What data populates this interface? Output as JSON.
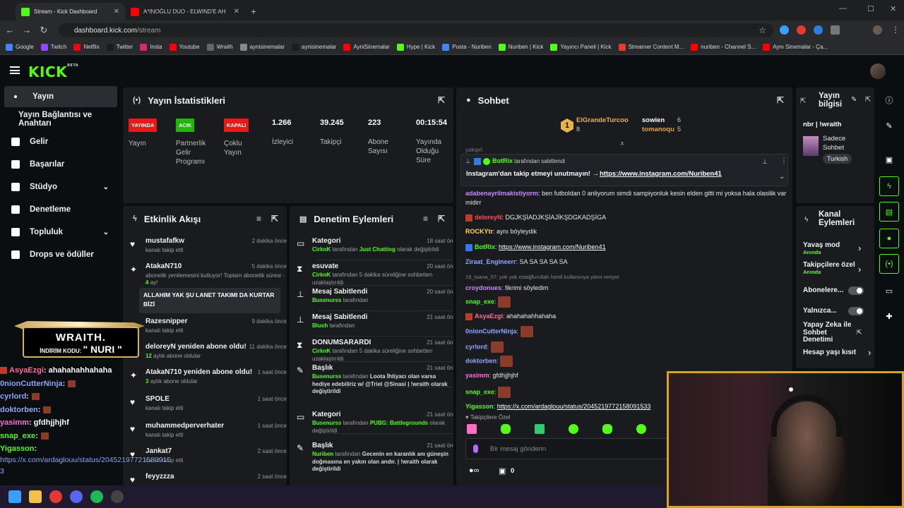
{
  "browser": {
    "tabs": [
      {
        "title": "Stream - Kick Dashboard",
        "color": "#53fc18"
      },
      {
        "title": "A*INOĞLU DUO - ELWIND'E AH",
        "color": "#ff0000"
      }
    ],
    "url_host": "dashboard.kick.com",
    "url_path": "/stream",
    "bookmarks": [
      {
        "label": "Google",
        "color": "#4285f4"
      },
      {
        "label": "Twitch",
        "color": "#9146ff"
      },
      {
        "label": "Netflix",
        "color": "#e50914"
      },
      {
        "label": "Twitter",
        "color": "#1d1d1d"
      },
      {
        "label": "Insta",
        "color": "#d62976"
      },
      {
        "label": "Youtube",
        "color": "#ff0000"
      },
      {
        "label": "Wraith",
        "color": "#666666"
      },
      {
        "label": "aynisinemalar",
        "color": "#888888"
      },
      {
        "label": "aynisinemalar",
        "color": "#1d1d1d"
      },
      {
        "label": "AyniSinemalar",
        "color": "#ff0000"
      },
      {
        "label": "Hype | Kick",
        "color": "#53fc18"
      },
      {
        "label": "Posta - Nuriben",
        "color": "#4285f4"
      },
      {
        "label": "Nuriben | Kick",
        "color": "#53fc18"
      },
      {
        "label": "Yayıncı Paneli | Kick",
        "color": "#53fc18"
      },
      {
        "label": "Streamer Content M...",
        "color": "#e53935"
      },
      {
        "label": "nuriben - Channel S...",
        "color": "#ff0000"
      },
      {
        "label": "Aynı Sinemalar - Ça...",
        "color": "#ff0000"
      }
    ]
  },
  "logo": {
    "text": "KICK",
    "beta": "BETA"
  },
  "sidebar": {
    "items": [
      {
        "label": "Yayın"
      },
      {
        "label": "Yayın Bağlantısı ve Anahtarı"
      },
      {
        "label": "Gelir"
      },
      {
        "label": "Başarılar"
      },
      {
        "label": "Stüdyo"
      },
      {
        "label": "Denetleme"
      },
      {
        "label": "Topluluk"
      },
      {
        "label": "Drops ve ödüller"
      }
    ]
  },
  "overlay": {
    "promo_title": "WRAITH.",
    "promo_code_label": "İNDİRİM KODU:",
    "promo_code": "\" NURI \"",
    "chat": [
      {
        "user": "AsyaEzgi",
        "color": "#ff6e9c",
        "msg": "ahahahahhahaha"
      },
      {
        "user": "0nionCutterNinja",
        "color": "#8fa8ff",
        "msg": ""
      },
      {
        "user": "cyrlord",
        "color": "#8fa8ff",
        "msg": ""
      },
      {
        "user": "doktorben",
        "color": "#8fa8ff",
        "msg": ""
      },
      {
        "user": "yasimm",
        "color": "#ff6ee0",
        "msg": "gfdhjjhjhf"
      },
      {
        "user": "snap_exe",
        "color": "#53fc18",
        "msg": ""
      },
      {
        "user": "Yigasson",
        "color": "#53fc18",
        "msg": ""
      }
    ],
    "link_line1": "https://x.com/ardaglouu/status/20452197721580915",
    "link_line2": "3"
  },
  "stats": {
    "title": "Yayın İstatistikleri",
    "items": [
      {
        "badge": "YAYINDA",
        "color": "#e91916",
        "label": "Yayın"
      },
      {
        "badge": "ACIK",
        "color": "#1db800",
        "label": "Partnerlik Gelir Programı"
      },
      {
        "badge": "KAPALI",
        "color": "#e91916",
        "label": "Çoklu Yayın"
      },
      {
        "value": "1.266",
        "label": "İzleyici"
      },
      {
        "value": "39.245",
        "label": "Takipçi"
      },
      {
        "value": "223",
        "label": "Abone Sayısı"
      },
      {
        "value": "00:15:54",
        "label": "Yayında Olduğu Süre"
      }
    ]
  },
  "feed": {
    "title": "Etkinlik Akışı",
    "highlight": "ALLAHIM YAK ŞU LANET TAKIMI DA KURTAR BİZİ",
    "items": [
      {
        "name": "mustafafkw",
        "sub": "kanalı takip etti",
        "time": "2 dakika önce",
        "icon": "♥"
      },
      {
        "name": "AtakaN710",
        "sub": "abonelik yenilemesini kutluyor! Toplam abonelik süresi -",
        "sub_green": "4",
        "sub2": "ay!",
        "time": "5 dakika önce",
        "icon": "✦"
      },
      {
        "name": "Razesnipper",
        "sub": "kanalı takip etti",
        "time": "9 dakika önce",
        "icon": "♥"
      },
      {
        "name": "deloreyN yeniden abone oldu!",
        "sub_green": "12",
        "sub": "aylık abone oldular",
        "time": "11 dakika önce",
        "icon": "✦"
      },
      {
        "name": "AtakaN710 yeniden abone oldu!",
        "sub_green": "3",
        "sub": "aylık abone oldular",
        "time": "1 saat önce",
        "icon": "✦"
      },
      {
        "name": "SPOLE",
        "sub": "kanalı takip etti",
        "time": "1 saat önce",
        "icon": "♥"
      },
      {
        "name": "muhammedperverhater",
        "sub": "kanalı takip etti",
        "time": "1 saat önce",
        "icon": "♥"
      },
      {
        "name": "Jankat7",
        "sub": "kanalı takip etti",
        "time": "2 saat önce",
        "icon": "♥"
      },
      {
        "name": "feyyzzza",
        "sub": "",
        "time": "2 saat önce",
        "icon": "♥"
      }
    ]
  },
  "mod": {
    "title": "Denetim Eylemleri",
    "items": [
      {
        "icon": "▭",
        "name": "Kategori",
        "time": "18 saat önce",
        "actor": "CirknK",
        "text": " tarafından ",
        "green2": "Just Chatting",
        "text2": " olarak değiştirildi"
      },
      {
        "icon": "⧗",
        "name": "esuvate",
        "time": "20 saat önce",
        "actor": "CirknK",
        "text": " tarafından 5 dakika süreliğine sohbetten uzaklaştırıldı",
        "green2": "",
        "text2": ""
      },
      {
        "icon": "⊥",
        "name": "Mesaj Sabitlendi",
        "time": "20 saat önce",
        "actor": "Busenurss",
        "text": " tarafından",
        "green2": "",
        "text2": ""
      },
      {
        "icon": "⊥",
        "name": "Mesaj Sabitlendi",
        "time": "21 saat önce",
        "actor": "Blush",
        "text": " tarafından",
        "green2": "",
        "text2": ""
      },
      {
        "icon": "⧗",
        "name": "DONUMSARARDI",
        "time": "21 saat önce",
        "actor": "CirknK",
        "text": " tarafından 5 dakika süreliğine sohbetten uzaklaştırıldı",
        "green2": "",
        "text2": ""
      },
      {
        "icon": "✎",
        "name": "Başlık",
        "time": "21 saat önce",
        "actor": "Busenurss",
        "text": " tarafından ",
        "green2": "",
        "text2": "Loota İhtiyacı olan varsa hediye edebiliriz w/ @Triel @Sinasi | !wraith olarak değiştirildi"
      },
      {
        "icon": "▭",
        "name": "Kategori",
        "time": "21 saat önce",
        "actor": "Busenurss",
        "text": " tarafından ",
        "green2": "PUBG: Battlegrounds",
        "text2": " olarak değiştirildi"
      },
      {
        "icon": "✎",
        "name": "Başlık",
        "time": "21 saat önce",
        "actor": "Nuriben",
        "text": " tarafından ",
        "green2": "",
        "text2": "Gecenin en karanlık anı güneşin doğmasına en yakın olan andır. | !wraith olarak değiştirildi"
      }
    ]
  },
  "chat": {
    "title": "Sohbet",
    "leader": {
      "rank": "1",
      "name": "ElGrandeTurcoo",
      "score": "8",
      "p2": "sowien",
      "s2": "6",
      "p3": "tomanoqu",
      "s3": "5"
    },
    "faded_user": "yakqel:",
    "pinned": {
      "by": "BotRix",
      "suffix": "tarafından sabitlendi",
      "text": "Instagram'dan takip etmeyi unutmayın! → ",
      "link": "https://www.instagram.com/Nuriben41"
    },
    "messages": [
      {
        "user": "adabenayrilmakistiyorm",
        "color": "#c98bff",
        "text": "ben futboldan 0 anliyorum simdi sampiyonluk kesin elden gitti mi yoksa hala olasilik var midirr"
      },
      {
        "user": "deloreyN",
        "color": "#ff4d5a",
        "text": "DGJKŞİADJKŞİAJİKŞDGKADŞİGA"
      },
      {
        "user": "ROCKYtr",
        "color": "#ffd84a",
        "text": "aynı böyleydik"
      },
      {
        "user": "BotRix",
        "color": "#53fc18",
        "text": "https://www.instagram.com/Nuriben41"
      },
      {
        "user": "Ziraat_Engineerr",
        "color": "#8fa8ff",
        "text": "SA SA SA SA SA"
      },
      {
        "user": "reply",
        "color": "#888888",
        "text": "19_tuana_07: yok yok estağfurullah İsimli kullanıcıya yanıt veriyor"
      },
      {
        "user": "croydonues",
        "color": "#c98bff",
        "text": "fikrimi söyledim"
      },
      {
        "user": "snap_exe",
        "color": "#53fc18",
        "text": ""
      },
      {
        "user": "AsyaEzgi",
        "color": "#ff6e9c",
        "text": "ahahahahhahaha"
      },
      {
        "user": "0nionCutterNinja",
        "color": "#8fa8ff",
        "text": ""
      },
      {
        "user": "cyrlord",
        "color": "#8fa8ff",
        "text": ""
      },
      {
        "user": "doktorben",
        "color": "#8fa8ff",
        "text": ""
      },
      {
        "user": "yasimm",
        "color": "#ff6ee0",
        "text": "gfdhjjhjhf"
      },
      {
        "user": "snap_exe",
        "color": "#53fc18",
        "text": ""
      },
      {
        "user": "Yigasson",
        "color": "#53fc18",
        "text": "https://x.com/ardaglouu/status/2045219772158091533"
      }
    ],
    "followers_only": "Takipçilere Özel",
    "placeholder": "Bir mesaj gönderin",
    "count": "0"
  },
  "info": {
    "title": "Yayın bilgisi",
    "stream_title": "nbr | !wraith",
    "category": "Sadece Sohbet",
    "language": "Turkish"
  },
  "channel": {
    "title": "Kanal Eylemleri",
    "rows": [
      {
        "label": "Yavaş mod",
        "sub": "Anında"
      },
      {
        "label": "Takipçilere özel",
        "sub": "Anında"
      },
      {
        "label": "Abonelere...",
        "sub": ""
      },
      {
        "label": "Yalnızca...",
        "sub": ""
      },
      {
        "label": "Yapay Zeka ile Sohbet Denetimi",
        "sub": ""
      },
      {
        "label": "Hesap yaşı kısıt",
        "sub": ""
      }
    ]
  }
}
